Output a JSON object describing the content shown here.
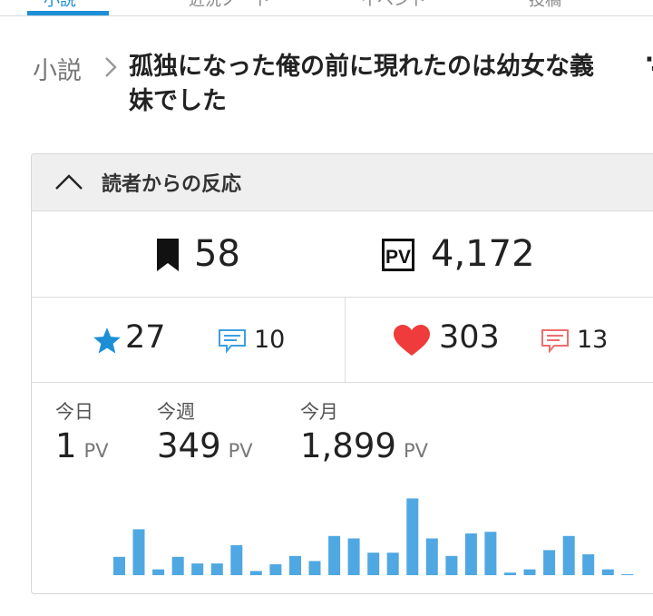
{
  "nav": {
    "tabs": [
      {
        "label": "小説",
        "active": true
      },
      {
        "label": "近況ノート",
        "active": false
      },
      {
        "label": "イベント",
        "active": false
      },
      {
        "label": "投稿",
        "active": false
      }
    ]
  },
  "breadcrumb": {
    "section": "小説"
  },
  "novel": {
    "title": "孤独になった俺の前に現れたのは幼女な義妹でした"
  },
  "reactions": {
    "header": "読者からの反応",
    "bookmarks": "58",
    "pv_total": "4,172",
    "stars": "27",
    "star_comments": "10",
    "hearts": "303",
    "heart_comments": "13"
  },
  "pv_stats": {
    "today": {
      "label": "今日",
      "value": "1",
      "unit": "PV"
    },
    "week": {
      "label": "今週",
      "value": "349",
      "unit": "PV"
    },
    "month": {
      "label": "今月",
      "value": "1,899",
      "unit": "PV"
    }
  },
  "colors": {
    "accent": "#1d8fd6",
    "bar": "#4fa8e2",
    "heart": "#ef3b3b",
    "comment_red": "#ee6e6e",
    "comment_blue": "#3d9fe0"
  },
  "chart_data": {
    "type": "bar",
    "categories": [
      "1",
      "2",
      "3",
      "4",
      "5",
      "6",
      "7",
      "8",
      "9",
      "10",
      "11",
      "12",
      "13",
      "14",
      "15",
      "16",
      "17",
      "18",
      "19",
      "20",
      "21",
      "22",
      "23",
      "24",
      "25",
      "26",
      "27",
      "28",
      "29",
      "30"
    ],
    "values": [
      22,
      55,
      7,
      22,
      14,
      14,
      36,
      5,
      13,
      23,
      17,
      47,
      44,
      27,
      27,
      92,
      44,
      23,
      50,
      52,
      3,
      7,
      30,
      47,
      25,
      7,
      1
    ],
    "title": "",
    "xlabel": "",
    "ylabel": "",
    "ylim": [
      0,
      100
    ]
  }
}
